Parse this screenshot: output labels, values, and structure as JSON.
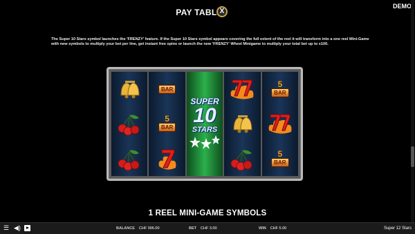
{
  "header": {
    "title": "PAY TABLE",
    "close_label": "X",
    "demo_label": "DEMO"
  },
  "description": "The Super 10 Stars symbol launches the 'FRENZY' feature. If the Super 10 Stars symbol appears covering the full extent of the reel it will transform into a one reel Mini-Game with new symbols to multiply your bet per line, get instant free spins or launch the new 'FRENZY' Wheel Minigame to multiply your total bet up to x100.",
  "reels": {
    "col1": [
      "bell",
      "cherries",
      "cherries"
    ],
    "col2": [
      "bar",
      "5bar",
      "seven"
    ],
    "wild": {
      "line1": "SUPER",
      "line2": "10",
      "line3": "STARS"
    },
    "col4": [
      "seven-flame",
      "bell",
      "cherries"
    ],
    "col5": [
      "5bar",
      "seven-flame",
      "5bar"
    ],
    "bar_label": "BAR",
    "five_label": "5"
  },
  "subtitle": "1 REEL MINI-GAME SYMBOLS",
  "footer": {
    "balance_label": "BALANCE",
    "balance_value": "CHF 996.00",
    "bet_label": "BET",
    "bet_value": "CHF 3.00",
    "win_label": "WIN",
    "win_value": "CHF 5.00",
    "game_name": "Super 12 Stars"
  },
  "colors": {
    "accent_gold": "#c9a44a",
    "reel_blue": "#1a3558",
    "wild_green": "#2bb04a"
  }
}
